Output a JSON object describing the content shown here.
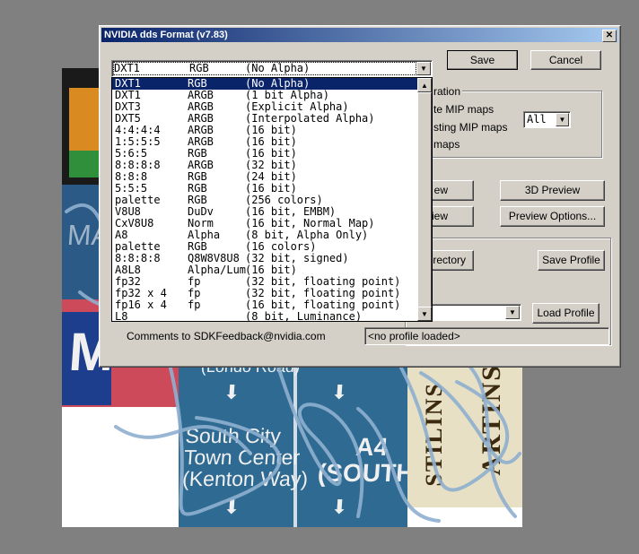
{
  "dialog": {
    "title": "NVIDIA dds Format (v7.83)",
    "close_glyph": "✕",
    "format_select": {
      "format": "DXT1",
      "channels": "RGB",
      "desc": "(No Alpha)"
    },
    "format_options": [
      {
        "format": "DXT1",
        "channels": "RGB",
        "desc": "(No Alpha)",
        "selected": true
      },
      {
        "format": "DXT1",
        "channels": "ARGB",
        "desc": "(1 bit Alpha)"
      },
      {
        "format": "DXT3",
        "channels": "ARGB",
        "desc": "(Explicit Alpha)"
      },
      {
        "format": "DXT5",
        "channels": "ARGB",
        "desc": "(Interpolated Alpha)"
      },
      {
        "format": "4:4:4:4",
        "channels": "ARGB",
        "desc": "(16 bit)"
      },
      {
        "format": "1:5:5:5",
        "channels": "ARGB",
        "desc": "(16 bit)"
      },
      {
        "format": "5:6:5",
        "channels": "RGB",
        "desc": "(16 bit)"
      },
      {
        "format": "8:8:8:8",
        "channels": "ARGB",
        "desc": "(32 bit)"
      },
      {
        "format": "8:8:8",
        "channels": "RGB",
        "desc": "(24 bit)"
      },
      {
        "format": "5:5:5",
        "channels": "RGB",
        "desc": "(16 bit)"
      },
      {
        "format": "palette",
        "channels": "RGB",
        "desc": "(256 colors)"
      },
      {
        "format": "V8U8",
        "channels": "DuDv",
        "desc": "(16 bit, EMBM)"
      },
      {
        "format": "CxV8U8",
        "channels": "Norm",
        "desc": "(16 bit, Normal Map)"
      },
      {
        "format": "A8",
        "channels": "Alpha",
        "desc": "(8 bit, Alpha Only)"
      },
      {
        "format": "palette",
        "channels": "RGB",
        "desc": "(16 colors)"
      },
      {
        "format": "8:8:8:8",
        "channels": "Q8W8V8U8",
        "desc": "(32 bit, signed)"
      },
      {
        "format": "A8L8",
        "channels": "Alpha/Lum",
        "desc": "(16 bit)"
      },
      {
        "format": "fp32",
        "channels": "fp",
        "desc": "(32 bit, floating point)"
      },
      {
        "format": "fp32 x 4",
        "channels": "fp",
        "desc": "(32 bit, floating point)"
      },
      {
        "format": "fp16 x 4",
        "channels": "fp",
        "desc": "(16 bit, floating point)"
      },
      {
        "format": "L8",
        "channels": "",
        "desc": "(8 bit, Luminance)"
      }
    ],
    "buttons": {
      "save": "Save",
      "cancel": "Cancel",
      "preview": "ew",
      "preview2": "eview",
      "preview_3d": "3D Preview",
      "preview_options": "Preview Options...",
      "directory": "irectory",
      "save_profile": "Save Profile",
      "load_profile": "Load Profile"
    },
    "mip": {
      "group_label": "ration",
      "option1": "te MIP maps",
      "option2": "sting MIP maps",
      "option3": "maps",
      "levels_value": "All"
    },
    "footer": {
      "feedback": "Comments to SDKFeedback@nvidia.com",
      "profile_status": "<no profile loaded>"
    }
  },
  "background": {
    "signs": {
      "south_city": "South City\nTown Center\n(Kenton Way)",
      "a4": "A4\n(SOUTH)",
      "partial_top": "(Londo Road)",
      "m_letter": "M",
      "ma_partial": "MA",
      "vert1": "STILINS",
      "vert2": "ARTINS"
    }
  }
}
